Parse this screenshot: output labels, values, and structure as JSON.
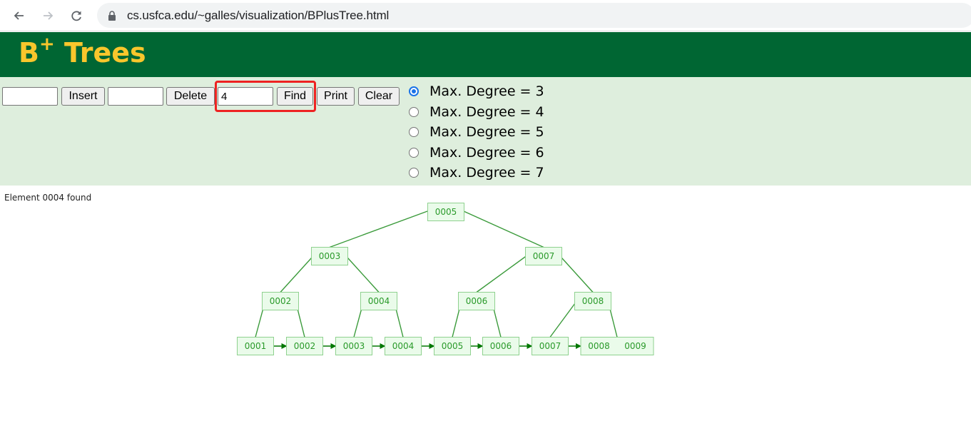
{
  "browser": {
    "url": "cs.usfca.edu/~galles/visualization/BPlusTree.html",
    "back_icon": "arrow-left-icon",
    "forward_icon": "arrow-right-icon",
    "reload_icon": "reload-icon",
    "lock_icon": "lock-icon"
  },
  "header": {
    "title_main": "B",
    "title_sup": "+",
    "title_rest": " Trees",
    "bg_color": "#006633",
    "fg_color": "#f9c62c"
  },
  "controls": {
    "insert_input": {
      "value": "",
      "placeholder": ""
    },
    "insert_label": "Insert",
    "delete_input": {
      "value": "",
      "placeholder": ""
    },
    "delete_label": "Delete",
    "find_input": {
      "value": "4",
      "placeholder": ""
    },
    "find_label": "Find",
    "print_label": "Print",
    "clear_label": "Clear",
    "degree_options": [
      {
        "label": "Max. Degree = 3",
        "checked": true
      },
      {
        "label": "Max. Degree = 4",
        "checked": false
      },
      {
        "label": "Max. Degree = 5",
        "checked": false
      },
      {
        "label": "Max. Degree = 6",
        "checked": false
      },
      {
        "label": "Max. Degree = 7",
        "checked": false
      }
    ],
    "highlight_color": "#ee2222"
  },
  "status": {
    "message": "Element 0004 found"
  },
  "tree": {
    "node_fill": "#eafbea",
    "node_stroke": "#8fd18f",
    "edge_color": "#3a9a3a",
    "arrow_color": "#007700",
    "levels": [
      [
        {
          "id": "root",
          "keys": [
            "0005"
          ],
          "children": [
            "i3",
            "i7"
          ]
        }
      ],
      [
        {
          "id": "i3",
          "keys": [
            "0003"
          ],
          "children": [
            "i2",
            "i4"
          ]
        },
        {
          "id": "i7",
          "keys": [
            "0007"
          ],
          "children": [
            "i6",
            "i8"
          ]
        }
      ],
      [
        {
          "id": "i2",
          "keys": [
            "0002"
          ],
          "children": [
            "l1",
            "l2"
          ]
        },
        {
          "id": "i4",
          "keys": [
            "0004"
          ],
          "children": [
            "l3",
            "l4"
          ]
        },
        {
          "id": "i6",
          "keys": [
            "0006"
          ],
          "children": [
            "l5",
            "l6"
          ]
        },
        {
          "id": "i8",
          "keys": [
            "0008"
          ],
          "children": [
            "l7",
            "l8"
          ]
        }
      ],
      [
        {
          "id": "l1",
          "keys": [
            "0001"
          ]
        },
        {
          "id": "l2",
          "keys": [
            "0002"
          ]
        },
        {
          "id": "l3",
          "keys": [
            "0003"
          ]
        },
        {
          "id": "l4",
          "keys": [
            "0004"
          ]
        },
        {
          "id": "l5",
          "keys": [
            "0005"
          ]
        },
        {
          "id": "l6",
          "keys": [
            "0006"
          ]
        },
        {
          "id": "l7",
          "keys": [
            "0007"
          ]
        },
        {
          "id": "l8",
          "keys": [
            "0008",
            "0009"
          ]
        }
      ]
    ]
  }
}
